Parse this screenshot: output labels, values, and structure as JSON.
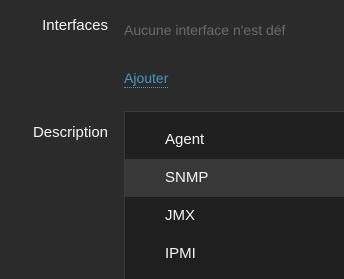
{
  "form": {
    "interfaces_label": "Interfaces",
    "interfaces_empty_text": "Aucune interface n'est déf",
    "add_link": "Ajouter",
    "description_label": "Description"
  },
  "dropdown": {
    "items": [
      {
        "label": "Agent",
        "highlighted": false
      },
      {
        "label": "SNMP",
        "highlighted": true
      },
      {
        "label": "JMX",
        "highlighted": false
      },
      {
        "label": "IPMI",
        "highlighted": false
      }
    ]
  },
  "colors": {
    "background": "#2b2b2b",
    "dropdown_background": "#1f1f1f",
    "highlight": "#383838",
    "link": "#4796c4",
    "muted_text": "#6b6b6b",
    "text": "#f2f2f2"
  }
}
